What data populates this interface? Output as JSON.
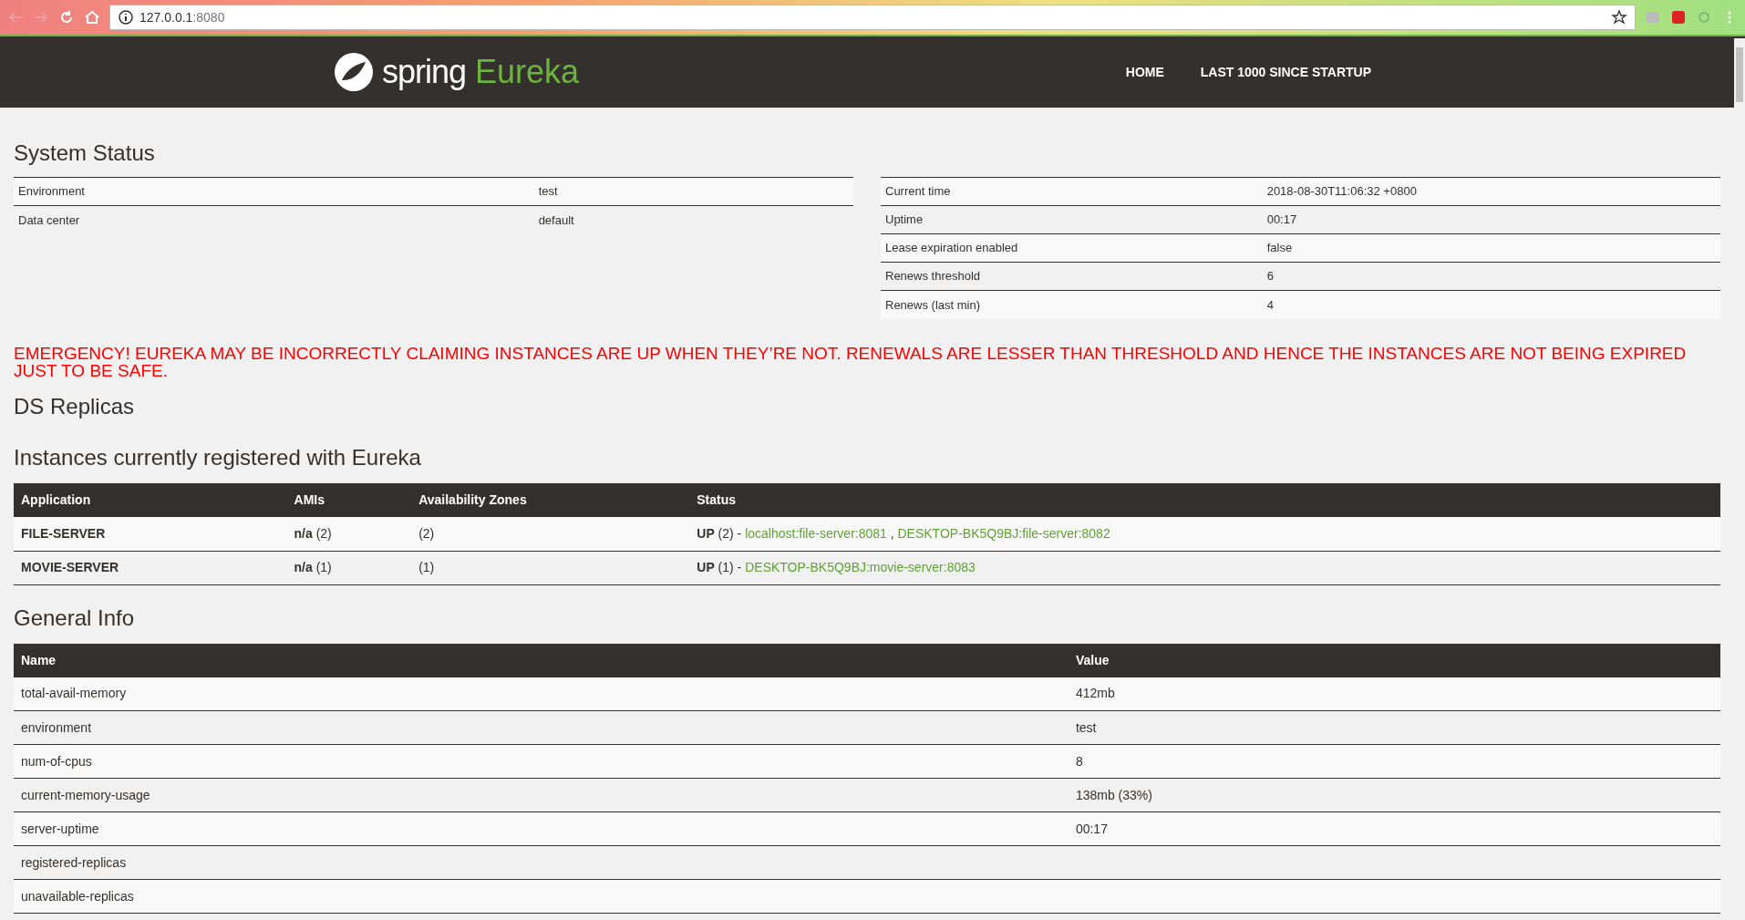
{
  "browser": {
    "url": "127.0.0.1",
    "port": ":8080"
  },
  "navbar": {
    "brand_word": "spring",
    "brand_product": "Eureka",
    "links": [
      "HOME",
      "LAST 1000 SINCE STARTUP"
    ]
  },
  "system_status": {
    "title": "System Status",
    "left": [
      {
        "label": "Environment",
        "value": "test"
      },
      {
        "label": "Data center",
        "value": "default"
      }
    ],
    "right": [
      {
        "label": "Current time",
        "value": "2018-08-30T11:06:32 +0800"
      },
      {
        "label": "Uptime",
        "value": "00:17"
      },
      {
        "label": "Lease expiration enabled",
        "value": "false"
      },
      {
        "label": "Renews threshold",
        "value": "6"
      },
      {
        "label": "Renews (last min)",
        "value": "4"
      }
    ]
  },
  "emergency": "EMERGENCY! EUREKA MAY BE INCORRECTLY CLAIMING INSTANCES ARE UP WHEN THEY’RE NOT. RENEWALS ARE LESSER THAN THRESHOLD AND HENCE THE INSTANCES ARE NOT BEING EXPIRED JUST TO BE SAFE.",
  "ds_replicas": {
    "title": "DS Replicas"
  },
  "instances": {
    "title": "Instances currently registered with Eureka",
    "columns": [
      "Application",
      "AMIs",
      "Availability Zones",
      "Status"
    ],
    "rows": [
      {
        "application": "FILE-SERVER",
        "amis": "**n/a** (2)",
        "zones": "(2)",
        "status": "**UP** (2) -",
        "links": [
          "localhost:file-server:8081",
          "DESKTOP-BK5Q9BJ:file-server:8082"
        ],
        "separator": ","
      },
      {
        "application": "MOVIE-SERVER",
        "amis": "**n/a** (1)",
        "zones": "(1)",
        "status": "**UP** (1) -",
        "links": [
          "DESKTOP-BK5Q9BJ:movie-server:8083"
        ]
      }
    ]
  },
  "general_info": {
    "title": "General Info",
    "columns": [
      "Name",
      "Value"
    ],
    "rows": [
      {
        "name": "total-avail-memory",
        "value": "412mb"
      },
      {
        "name": "environment",
        "value": "test"
      },
      {
        "name": "num-of-cpus",
        "value": "8"
      },
      {
        "name": "current-memory-usage",
        "value": "138mb (33%)"
      },
      {
        "name": "server-uptime",
        "value": "00:17"
      },
      {
        "name": "registered-replicas"
      },
      {
        "name": "unavailable-replicas"
      }
    ]
  }
}
